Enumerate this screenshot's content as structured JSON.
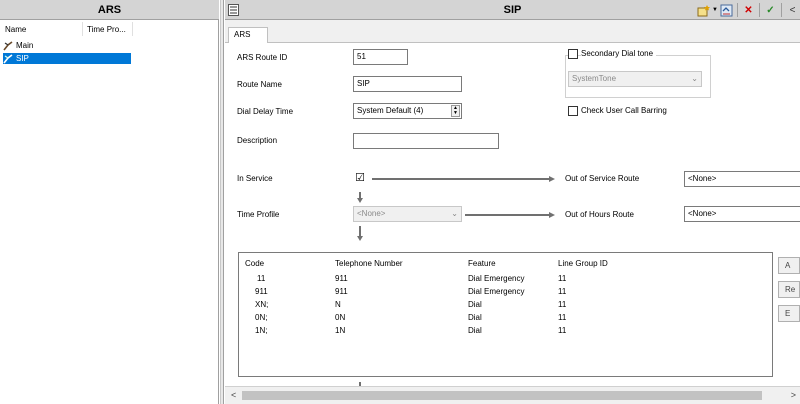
{
  "left": {
    "title": "ARS",
    "columns": [
      "Name",
      "Time Pro..."
    ],
    "items": [
      {
        "label": "Main",
        "selected": false
      },
      {
        "label": "SIP",
        "selected": true
      }
    ]
  },
  "right": {
    "title": "SIP",
    "tab": "ARS",
    "toolbar": {
      "close": "✕",
      "ok": "✓",
      "back": "<"
    },
    "form": {
      "route_id_label": "ARS Route ID",
      "route_id_value": "51",
      "route_name_label": "Route Name",
      "route_name_value": "SIP",
      "dial_delay_label": "Dial Delay Time",
      "dial_delay_value": "System Default (4)",
      "description_label": "Description",
      "description_value": "",
      "secondary_dial_label": "Secondary Dial tone",
      "system_tone_value": "SystemTone",
      "check_user_label": "Check User Call Barring",
      "in_service_label": "In Service",
      "in_service_checked": "☑",
      "oos_route_label": "Out of Service Route",
      "oos_route_value": "<None>",
      "time_profile_label": "Time Profile",
      "time_profile_value": "<None>",
      "ooh_route_label": "Out of Hours Route",
      "ooh_route_value": "<None>"
    },
    "table": {
      "headers": [
        "Code",
        "Telephone Number",
        "Feature",
        "Line Group ID"
      ],
      "rows": [
        [
          "11",
          "911",
          "Dial Emergency",
          "11"
        ],
        [
          "911",
          "911",
          "Dial Emergency",
          "11"
        ],
        [
          "XN;",
          "N",
          "Dial",
          "11"
        ],
        [
          "0N;",
          "0N",
          "Dial",
          "11"
        ],
        [
          "1N;",
          "1N",
          "Dial",
          "11"
        ]
      ]
    },
    "side_buttons": [
      "A",
      "Re",
      "E"
    ]
  },
  "colors": {
    "selection": "#0078d7",
    "close_red": "#d00000",
    "ok_green": "#2a8a2a"
  }
}
